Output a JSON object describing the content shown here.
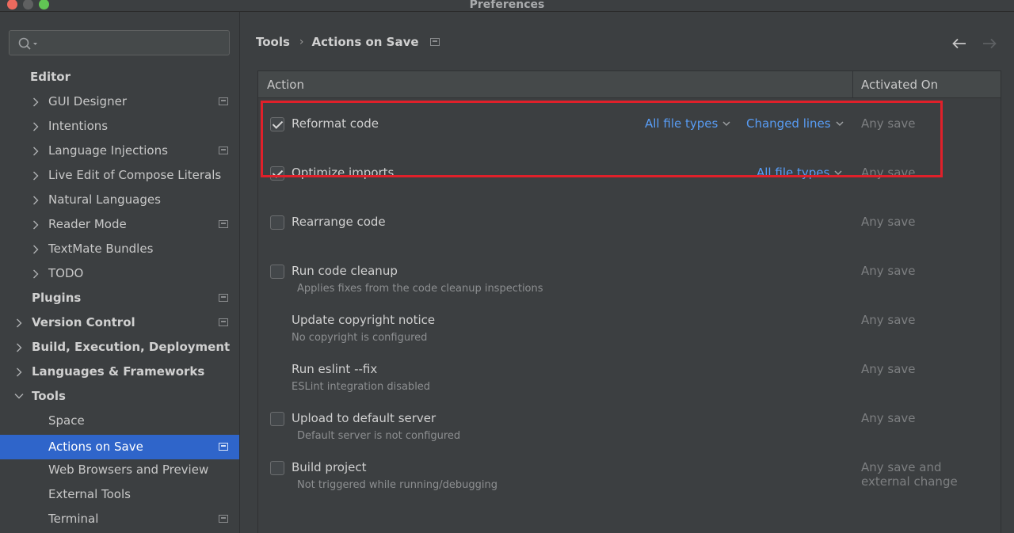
{
  "window": {
    "title": "Preferences"
  },
  "colors": {
    "accent": "#2f65ca",
    "link": "#589df6",
    "highlight": "#e0202a",
    "close": "#ed6a5e",
    "minimize": "#5f6061",
    "zoom": "#61c554"
  },
  "search": {
    "placeholder": ""
  },
  "sidebar": {
    "items": [
      {
        "label": "Editor"
      },
      {
        "label": "GUI Designer"
      },
      {
        "label": "Intentions"
      },
      {
        "label": "Language Injections"
      },
      {
        "label": "Live Edit of Compose Literals"
      },
      {
        "label": "Natural Languages"
      },
      {
        "label": "Reader Mode"
      },
      {
        "label": "TextMate Bundles"
      },
      {
        "label": "TODO"
      },
      {
        "label": "Plugins"
      },
      {
        "label": "Version Control"
      },
      {
        "label": "Build, Execution, Deployment"
      },
      {
        "label": "Languages & Frameworks"
      },
      {
        "label": "Tools"
      },
      {
        "label": "Space"
      },
      {
        "label": "Actions on Save",
        "selected": true
      },
      {
        "label": "Web Browsers and Preview"
      },
      {
        "label": "External Tools"
      },
      {
        "label": "Terminal"
      }
    ]
  },
  "breadcrumb": {
    "parent": "Tools",
    "current": "Actions on Save"
  },
  "table": {
    "columns": {
      "action": "Action",
      "activated_on": "Activated On"
    },
    "rows": [
      {
        "title": "Reformat code",
        "checked": true,
        "subtitle": "",
        "file_types": "All file types",
        "scope": "Changed lines",
        "activated_on": "Any save"
      },
      {
        "title": "Optimize imports",
        "checked": true,
        "subtitle": "",
        "file_types": "All file types",
        "activated_on": "Any save"
      },
      {
        "title": "Rearrange code",
        "checked": false,
        "subtitle": "",
        "activated_on": "Any save"
      },
      {
        "title": "Run code cleanup",
        "checked": false,
        "subtitle": "Applies fixes from the code cleanup inspections",
        "activated_on": "Any save"
      },
      {
        "title": "Update copyright notice",
        "subtitle": "No copyright is configured",
        "activated_on": "Any save"
      },
      {
        "title": "Run eslint --fix",
        "subtitle": "ESLint integration disabled",
        "activated_on": "Any save"
      },
      {
        "title": "Upload to default server",
        "checked": false,
        "subtitle": "Default server is not configured",
        "activated_on": "Any save"
      },
      {
        "title": "Build project",
        "checked": false,
        "subtitle": "Not triggered while running/debugging",
        "activated_on": "Any save and external change"
      }
    ]
  }
}
